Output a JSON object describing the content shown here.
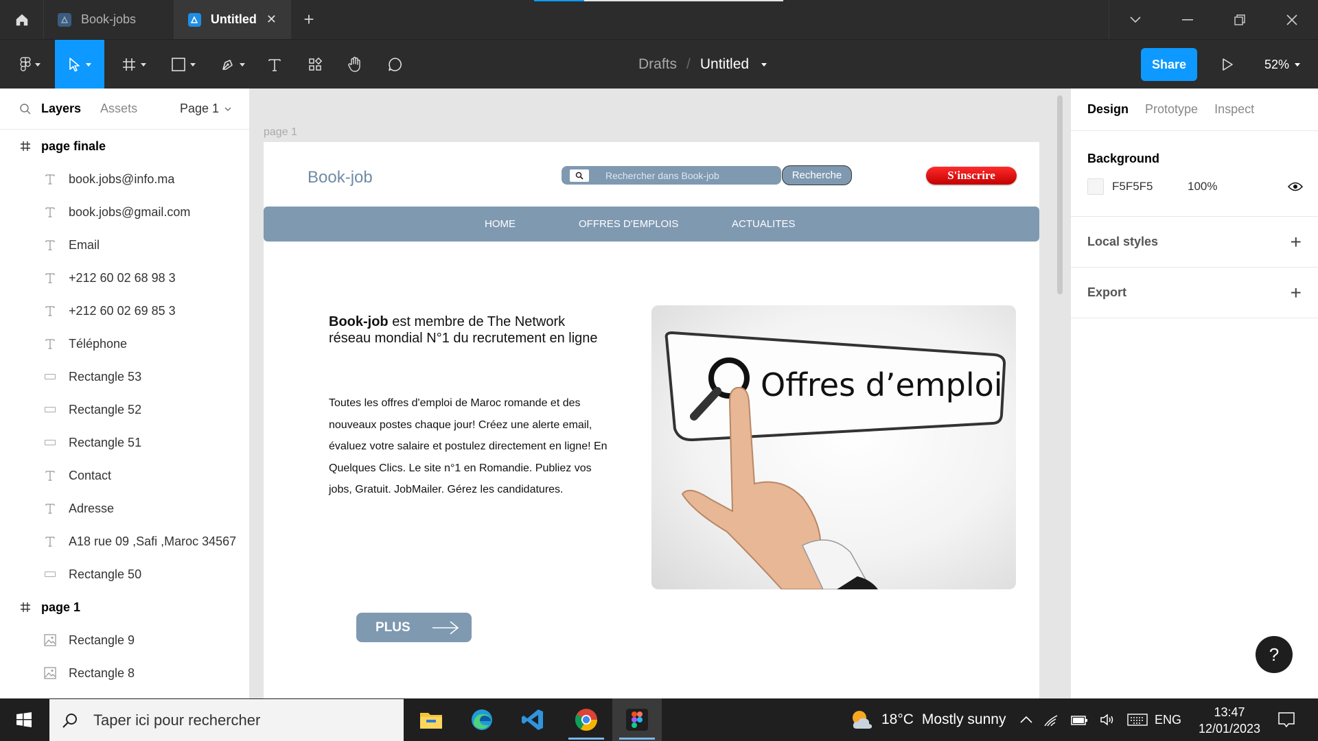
{
  "titlebar": {
    "tabs": [
      {
        "label": "Book-jobs",
        "active": false
      },
      {
        "label": "Untitled",
        "active": true
      }
    ],
    "active_tab_close": "✕",
    "new_tab": "+",
    "load_progress": 0.2
  },
  "toolbar": {
    "breadcrumb_parent": "Drafts",
    "breadcrumb_separator": "/",
    "file_name": "Untitled",
    "share_label": "Share",
    "zoom": "52%"
  },
  "left_panel": {
    "tab_layers": "Layers",
    "tab_assets": "Assets",
    "page_selector": "Page 1",
    "frames": [
      {
        "name": "page finale",
        "children": [
          {
            "type": "text",
            "name": "book.jobs@info.ma"
          },
          {
            "type": "text",
            "name": "book.jobs@gmail.com"
          },
          {
            "type": "text",
            "name": "Email"
          },
          {
            "type": "text",
            "name": "+212 60 02 68 98 3"
          },
          {
            "type": "text",
            "name": "+212 60 02 69 85 3"
          },
          {
            "type": "text",
            "name": "Téléphone"
          },
          {
            "type": "rect",
            "name": "Rectangle 53"
          },
          {
            "type": "rect",
            "name": "Rectangle 52"
          },
          {
            "type": "rect",
            "name": "Rectangle 51"
          },
          {
            "type": "text",
            "name": "Contact"
          },
          {
            "type": "text",
            "name": "Adresse"
          },
          {
            "type": "text",
            "name": "A18 rue 09 ,Safi ,Maroc 34567"
          },
          {
            "type": "rect",
            "name": "Rectangle 50"
          }
        ]
      },
      {
        "name": "page 1",
        "children": [
          {
            "type": "image",
            "name": "Rectangle 9"
          },
          {
            "type": "image",
            "name": "Rectangle 8"
          }
        ]
      }
    ]
  },
  "canvas": {
    "frame_label": "page 1",
    "site": {
      "logo": "Book-job",
      "search_placeholder": "Rechercher dans Book-job",
      "search_button": "Recherche",
      "signup_button": "S'inscrire",
      "nav": [
        "HOME",
        "OFFRES D'EMPLOIS",
        "ACTUALITES"
      ],
      "intro_bold": "Book-job",
      "intro_rest": " est membre de The Network réseau mondial N°1 du recrutement en ligne",
      "description": "Toutes les offres d'emploi de Maroc romande et des nouveaux postes chaque jour! Créez une alerte email, évaluez votre salaire et postulez directement en ligne! En Quelques Clics. Le site n°1 en Romandie. Publiez vos jobs, Gratuit. JobMailer. Gérez les candidatures.",
      "hero_text": "Offres d’emploi",
      "more_button": "PLUS"
    }
  },
  "right_panel": {
    "tabs": [
      "Design",
      "Prototype",
      "Inspect"
    ],
    "background_title": "Background",
    "background_hex": "F5F5F5",
    "background_opacity": "100%",
    "local_styles": "Local styles",
    "export": "Export",
    "help": "?"
  },
  "taskbar": {
    "search_placeholder": "Taper ici pour rechercher",
    "weather_temp": "18°C",
    "weather_text": "Mostly sunny",
    "language": "ENG",
    "time": "13:47",
    "date": "12/01/2023"
  },
  "colors": {
    "figma_blue": "#0d99ff",
    "dark_chrome": "#2c2c2c",
    "site_blue_grey": "#7f99b1",
    "signup_red": "#e00000",
    "canvas_bg": "#e5e5e5"
  }
}
